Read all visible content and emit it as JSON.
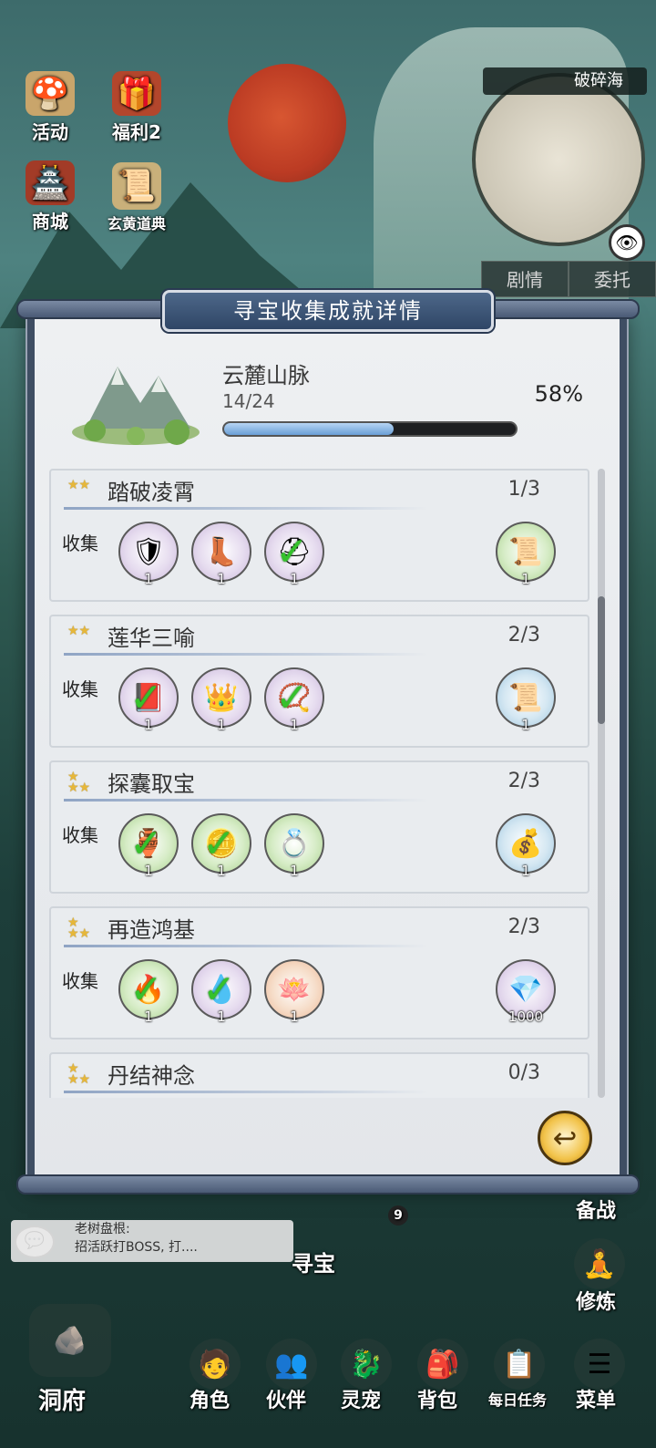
{
  "map": {
    "title": "破碎海"
  },
  "side_buttons": [
    {
      "label": "活动",
      "icon": "mushroom-icon"
    },
    {
      "label": "福利2",
      "icon": "gift-icon"
    },
    {
      "label": "商城",
      "icon": "shop-building-icon"
    },
    {
      "label": "玄黄道典",
      "icon": "scroll-book-icon"
    }
  ],
  "tabs": {
    "story": "剧情",
    "commission": "委托"
  },
  "modal": {
    "title": "寻宝收集成就详情",
    "region": {
      "name": "云麓山脉",
      "count": "14/24",
      "percent_text": "58%",
      "progress": 0.58
    },
    "section_label": "收集",
    "achievements": [
      {
        "title": "踏破凌霄",
        "progress": "1/3",
        "star_icon": "two-star-icon",
        "items": [
          {
            "icon": "golden-armor-icon",
            "qty": "1",
            "done": false,
            "style": "purple"
          },
          {
            "icon": "black-boots-icon",
            "qty": "1",
            "done": false,
            "style": "purple"
          },
          {
            "icon": "gold-helmet-icon",
            "qty": "1",
            "done": true,
            "style": "purple"
          }
        ],
        "reward": {
          "icon": "scroll-icon",
          "qty": "1",
          "style": "green"
        }
      },
      {
        "title": "莲华三喻",
        "progress": "2/3",
        "star_icon": "two-star-icon",
        "items": [
          {
            "icon": "red-book-icon",
            "qty": "1",
            "done": true,
            "style": "purple"
          },
          {
            "icon": "crown-icon",
            "qty": "1",
            "done": false,
            "style": "purple"
          },
          {
            "icon": "prayer-beads-icon",
            "qty": "1",
            "done": true,
            "style": "purple"
          }
        ],
        "reward": {
          "icon": "scroll-icon",
          "qty": "1",
          "style": "blue"
        }
      },
      {
        "title": "探囊取宝",
        "progress": "2/3",
        "star_icon": "three-star-icon",
        "items": [
          {
            "icon": "gourd-icon",
            "qty": "1",
            "done": true,
            "style": "green"
          },
          {
            "icon": "coin-icon",
            "qty": "1",
            "done": true,
            "style": "green"
          },
          {
            "icon": "ring-icon",
            "qty": "1",
            "done": false,
            "style": "green"
          }
        ],
        "reward": {
          "icon": "treasure-bag-icon",
          "qty": "1",
          "style": "blue"
        }
      },
      {
        "title": "再造鸿基",
        "progress": "2/3",
        "star_icon": "three-star-icon",
        "items": [
          {
            "icon": "blue-flame-icon",
            "qty": "1",
            "done": true,
            "style": "green"
          },
          {
            "icon": "blue-spirit-icon",
            "qty": "1",
            "done": true,
            "style": "purple"
          },
          {
            "icon": "golden-lotus-icon",
            "qty": "1",
            "done": false,
            "style": "orange"
          }
        ],
        "reward": {
          "icon": "gold-crystal-icon",
          "qty": "1000",
          "style": "purple"
        }
      },
      {
        "title": "丹结神念",
        "progress": "0/3",
        "star_icon": "three-star-icon"
      }
    ]
  },
  "chat": {
    "name": "老树盘根:",
    "message": "招活跃打BOSS, 打...."
  },
  "side_right": {
    "prepare": "备战",
    "cultivate": "修炼",
    "badge": "9"
  },
  "treasure_label": "寻宝",
  "bottom_nav": [
    {
      "label": "洞府",
      "icon": "cave-icon"
    },
    {
      "label": "角色",
      "icon": "character-icon"
    },
    {
      "label": "伙伴",
      "icon": "partner-icon"
    },
    {
      "label": "灵宠",
      "icon": "spirit-pet-icon"
    },
    {
      "label": "背包",
      "icon": "backpack-icon"
    },
    {
      "label": "每日任务",
      "icon": "daily-task-icon"
    },
    {
      "label": "菜单",
      "icon": "menu-icon"
    }
  ],
  "colors": {
    "progress_fill": "#6a9fd6",
    "check": "#35c12c",
    "banner": "#2f4666"
  }
}
